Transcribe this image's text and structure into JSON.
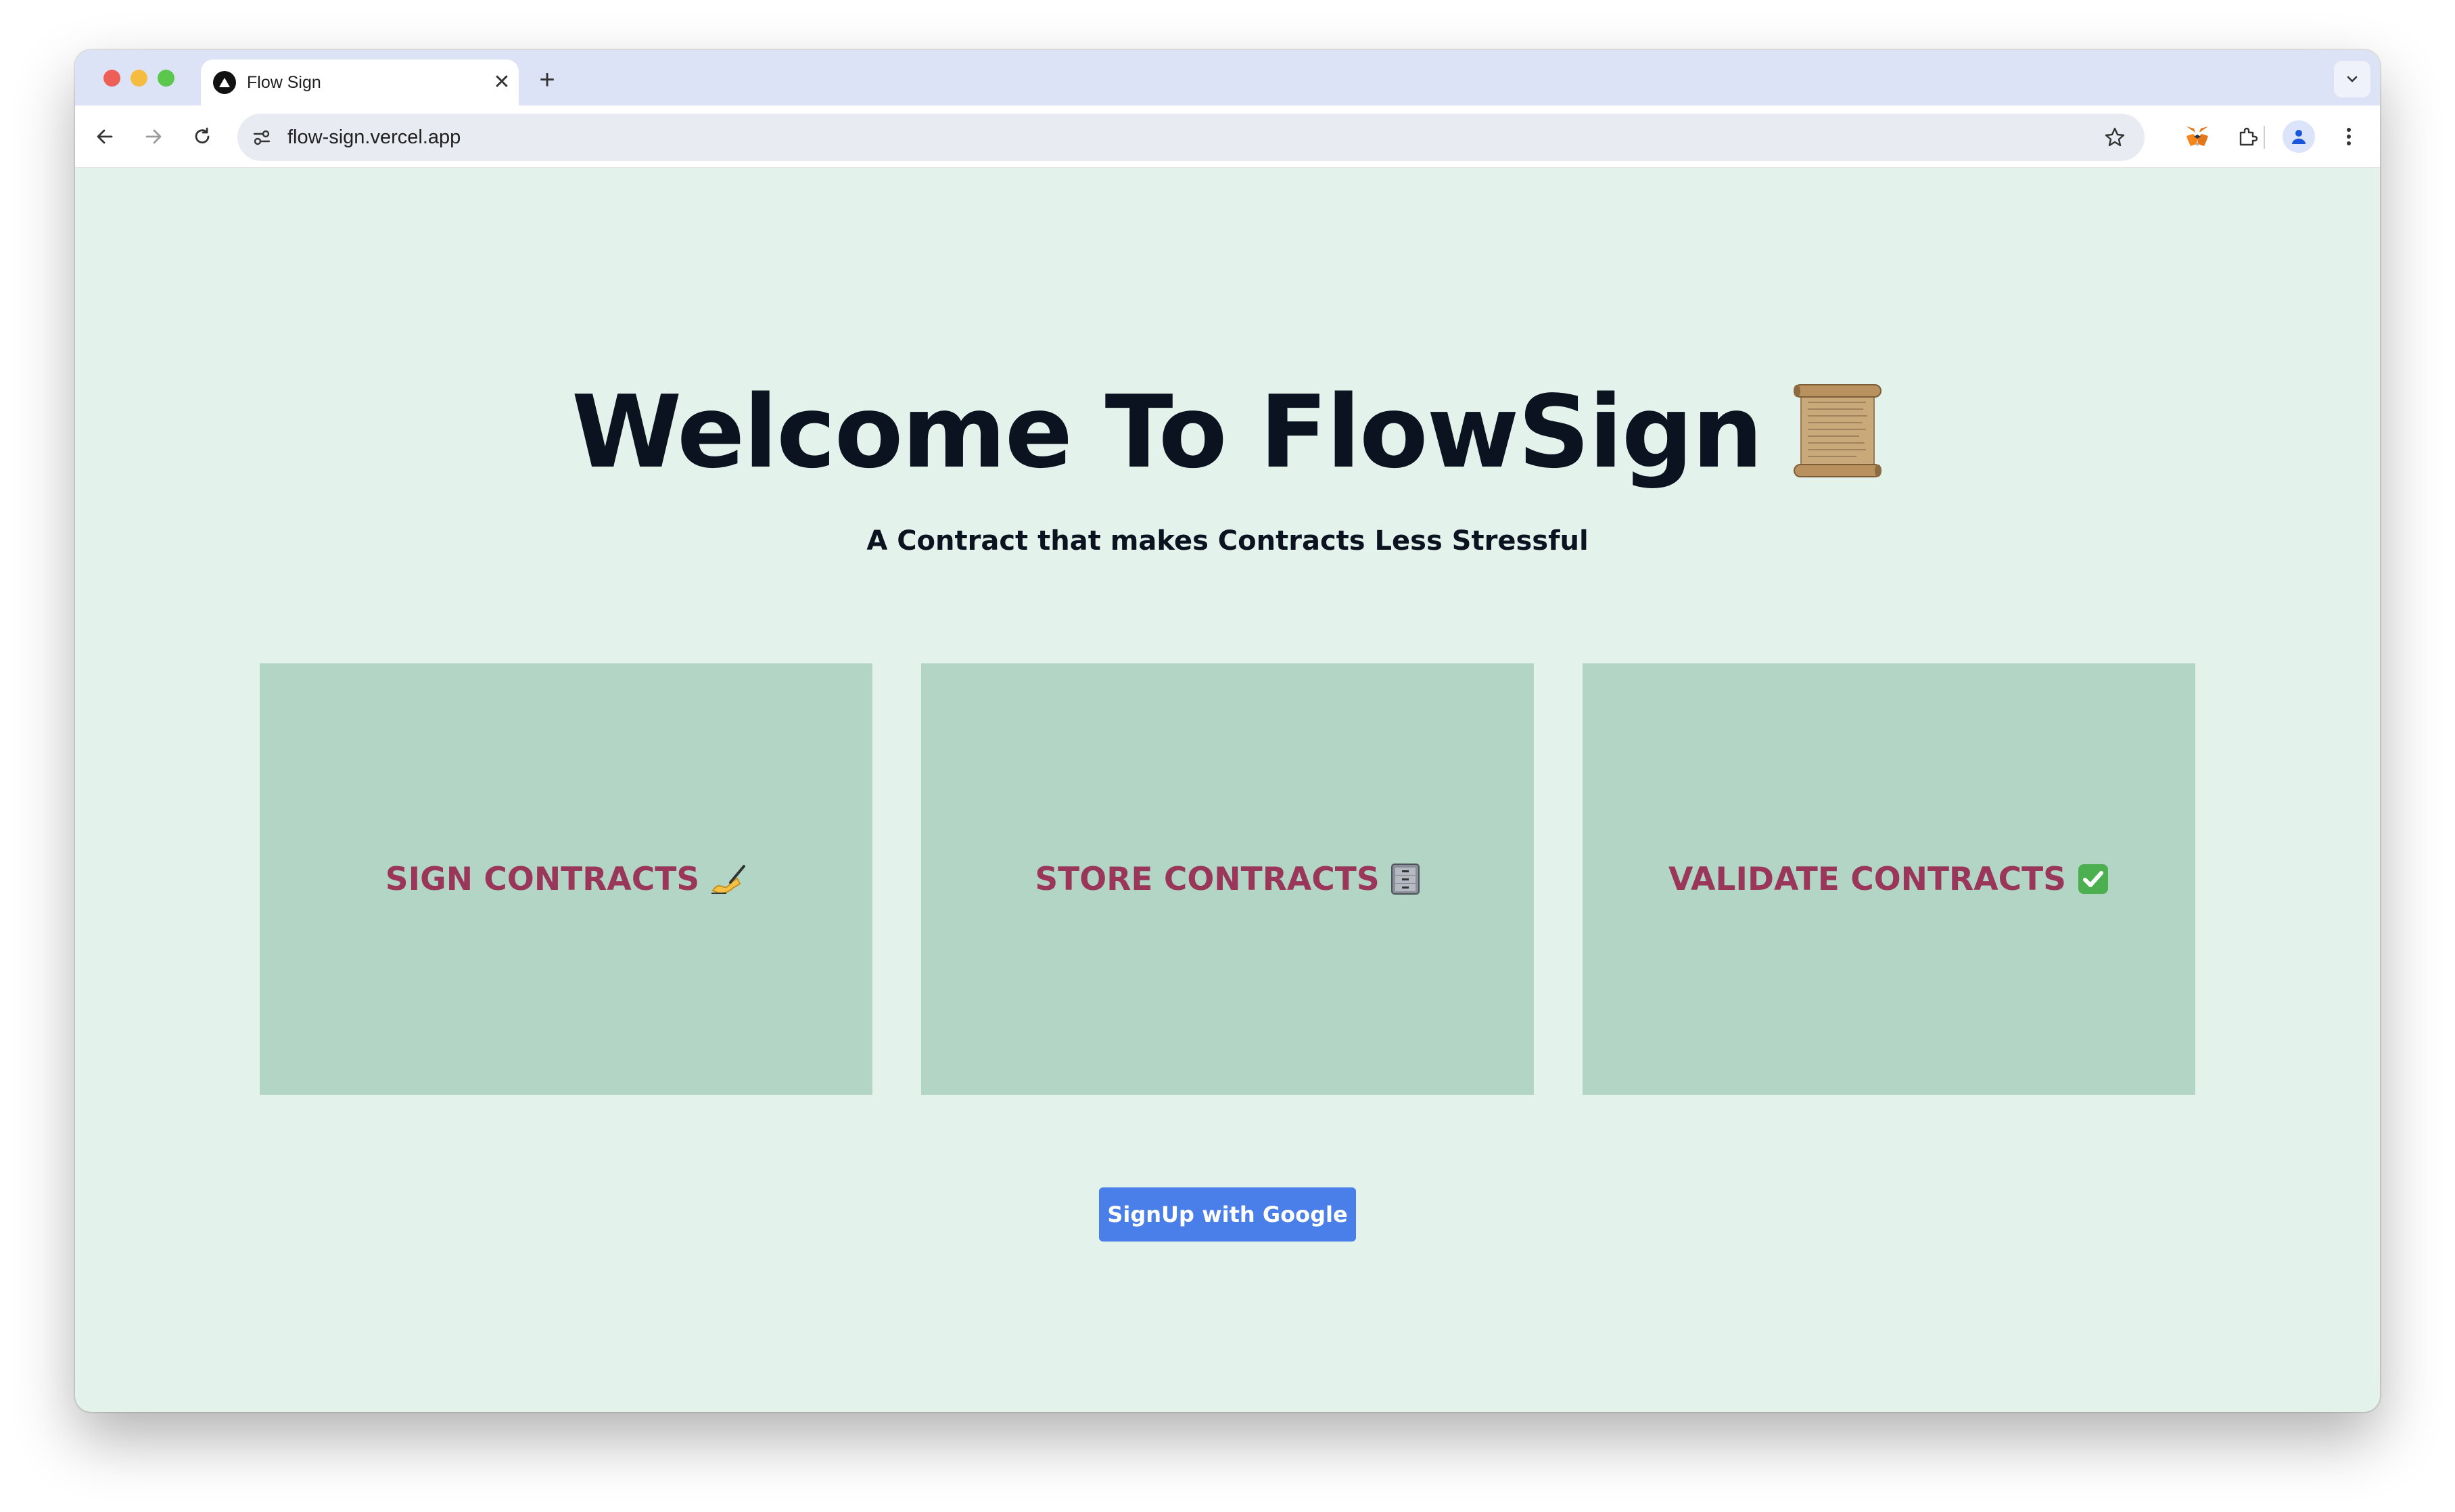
{
  "browser": {
    "tab": {
      "title": "Flow Sign",
      "close_glyph": "✕"
    },
    "new_tab_glyph": "+",
    "url": "flow-sign.vercel.app"
  },
  "page": {
    "headline": "Welcome To FlowSign",
    "headline_icon": "scroll-icon",
    "tagline": "A Contract that makes Contracts Less Stressful",
    "cards": [
      {
        "label": "SIGN CONTRACTS",
        "icon": "writing-hand-icon"
      },
      {
        "label": "STORE CONTRACTS",
        "icon": "file-cabinet-icon"
      },
      {
        "label": "VALIDATE CONTRACTS",
        "icon": "check-mark-icon"
      }
    ],
    "signup_button": "SignUp with Google"
  },
  "colors": {
    "page_background": "#e3f3ec",
    "card_background": "#b2d5c6",
    "card_text": "#99365a",
    "button": "#4a7ee8",
    "headline": "#0b1220"
  }
}
